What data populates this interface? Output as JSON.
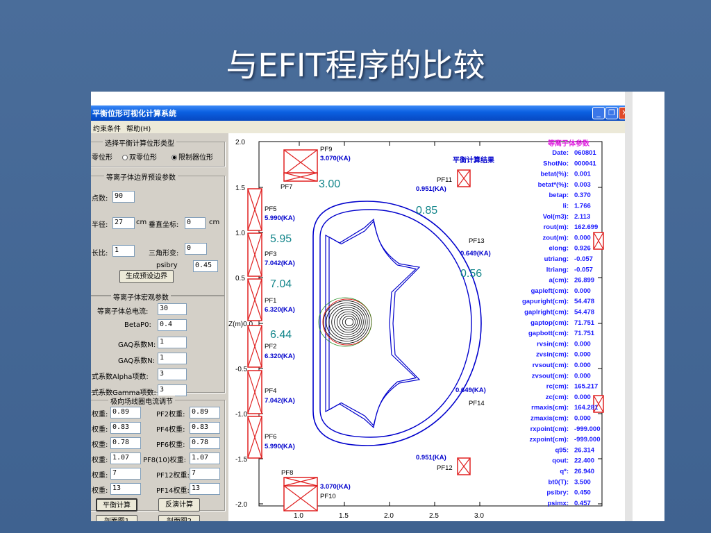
{
  "slide": {
    "title": "与EFIT程序的比较"
  },
  "window": {
    "title": "平衡位形可视化计算系统",
    "menu": [
      "约束条件",
      "帮助(H)"
    ]
  },
  "panel": {
    "config_group": "选择平衡计算位形类型",
    "radio_options": [
      "零位形",
      "双零位形",
      "限制器位形"
    ],
    "boundary_group": "等离子体边界预设参数",
    "points_label": "点数:",
    "points_value": "90",
    "radius_label": "半径:",
    "radius_value": "27",
    "radius_unit": "cm",
    "vcoord_label": "垂直坐标:",
    "vcoord_value": "0",
    "vcoord_unit": "cm",
    "elong_label": "长比:",
    "elong_value": "1",
    "tri_label": "三角形变:",
    "tri_value": "0",
    "psibry_label": "psibry",
    "psibry_value": "0.45",
    "gen_boundary_button": "生成预设边界",
    "macro_group": "等离子体宏观参数",
    "current_label": "等离子体总电流:",
    "current_value": "30",
    "beta_label": "BetaP0:",
    "beta_value": "0.4",
    "gaqm_label": "GAQ系数M:",
    "gaqm_value": "1",
    "gaqn_label": "GAQ系数N:",
    "gaqn_value": "1",
    "alpha_label": "式系数Alpha项数:",
    "alpha_value": "3",
    "gamma_label": "式系数Gamma项数:",
    "gamma_value": "3",
    "coil_group": "极向场线圈电流调节",
    "coil_rows": [
      {
        "l1": "权重:",
        "v1": "0.89",
        "l2": "PF2权重:",
        "v2": "0.89"
      },
      {
        "l1": "权重:",
        "v1": "0.83",
        "l2": "PF4权重:",
        "v2": "0.83"
      },
      {
        "l1": "权重:",
        "v1": "0.78",
        "l2": "PF6权重:",
        "v2": "0.78"
      },
      {
        "l1": "权重:",
        "v1": "1.07",
        "l2": "PF8(10)权重:",
        "v2": "1.07"
      },
      {
        "l1": "权重:",
        "v1": "7",
        "l2": "PF12权重:",
        "v2": "7"
      },
      {
        "l1": "权重:",
        "v1": "13",
        "l2": "PF14权重:",
        "v2": "13"
      }
    ],
    "calc_button": "平衡计算",
    "inverse_button": "反演计算",
    "profile1_button": "剖面图1",
    "profile2_button": "剖面图2"
  },
  "plot": {
    "result_title": "平衡计算结果",
    "yticks": [
      "2.0",
      "1.5",
      "1.0",
      "0.5",
      "Z(m)0.0",
      "-0.5",
      "-1.0",
      "-1.5",
      "-2.0"
    ],
    "xticks": [
      "1.0",
      "1.5",
      "2.0",
      "2.5",
      "3.0"
    ],
    "coil_labels": {
      "PF9": "PF9",
      "PF9c": "3.070(KA)",
      "PF7": "PF7",
      "PF5": "PF5",
      "PF5c": "5.990(KA)",
      "PF3": "PF3",
      "PF3c": "7.042(KA)",
      "PF1": "PF1",
      "PF1c": "6.320(KA)",
      "PF2": "PF2",
      "PF2c": "6.320(KA)",
      "PF4": "PF4",
      "PF4c": "7.042(KA)",
      "PF6": "PF6",
      "PF6c": "5.990(KA)",
      "PF8": "PF8",
      "PF10c": "3.070(KA)",
      "PF10": "PF10",
      "PF11": "PF11",
      "PF11c": "0.951(KA)",
      "PF13": "PF13",
      "PF13c": "0.649(KA)",
      "PF14c": "0.649(KA)",
      "PF14": "PF14",
      "PF12c": "0.951(KA)",
      "PF12": "PF12"
    },
    "efit_values": {
      "v1": "3.00",
      "v2": "0.85",
      "v3": "5.95",
      "v4": "7.04",
      "v5": "0.56",
      "v6": "6.44"
    }
  },
  "params": {
    "title": "等离子体参数",
    "rows": [
      {
        "k": "Date:",
        "v": "060801"
      },
      {
        "k": "ShotNo:",
        "v": "000041"
      },
      {
        "k": "betat(%):",
        "v": "0.001"
      },
      {
        "k": "betat*(%):",
        "v": "0.003"
      },
      {
        "k": "betap:",
        "v": "0.370"
      },
      {
        "k": "li:",
        "v": "1.766"
      },
      {
        "k": "Vol(m3):",
        "v": "2.113"
      },
      {
        "k": "rout(m):",
        "v": "162.699"
      },
      {
        "k": "zout(m):",
        "v": "0.000"
      },
      {
        "k": "elong:",
        "v": "0.926"
      },
      {
        "k": "utriang:",
        "v": "-0.057"
      },
      {
        "k": "ltriang:",
        "v": "-0.057"
      },
      {
        "k": "a(cm):",
        "v": "26.899"
      },
      {
        "k": "gapleft(cm):",
        "v": "0.000"
      },
      {
        "k": "gapuright(cm):",
        "v": "54.478"
      },
      {
        "k": "gaplright(cm):",
        "v": "54.478"
      },
      {
        "k": "gaptop(cm):",
        "v": "71.751"
      },
      {
        "k": "gapbott(cm):",
        "v": "71.751"
      },
      {
        "k": "rvsin(cm):",
        "v": "0.000"
      },
      {
        "k": "zvsin(cm):",
        "v": "0.000"
      },
      {
        "k": "rvsout(cm):",
        "v": "0.000"
      },
      {
        "k": "zvsout(cm):",
        "v": "0.000"
      },
      {
        "k": "rc(cm):",
        "v": "165.217"
      },
      {
        "k": "zc(cm):",
        "v": "0.000"
      },
      {
        "k": "rmaxis(cm):",
        "v": "164.281"
      },
      {
        "k": "zmaxis(cm):",
        "v": "0.000"
      },
      {
        "k": "rxpoint(cm):",
        "v": "-999.000"
      },
      {
        "k": "zxpoint(cm):",
        "v": "-999.000"
      },
      {
        "k": "q95:",
        "v": "26.314"
      },
      {
        "k": "qout:",
        "v": "22.400"
      },
      {
        "k": "q*:",
        "v": "26.940"
      },
      {
        "k": "bt0(T):",
        "v": "3.500"
      },
      {
        "k": "psibry:",
        "v": "0.450"
      },
      {
        "k": "psimx:",
        "v": "0.457"
      }
    ]
  },
  "colors": {
    "frame": "#0000cc",
    "coil": "#e02020",
    "efit": "#12858a",
    "param_title": "#e020e0",
    "param_text": "#1a1aff"
  }
}
